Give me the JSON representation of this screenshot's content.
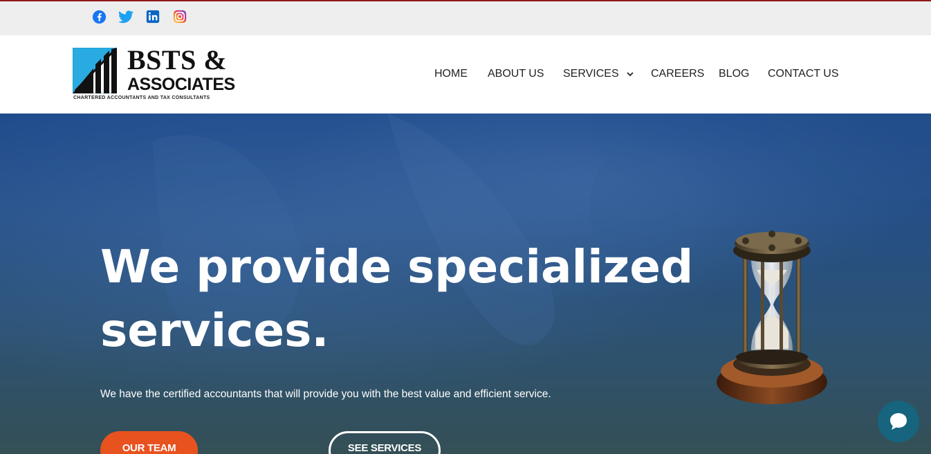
{
  "social": [
    {
      "name": "facebook-icon",
      "color": "#1877f2"
    },
    {
      "name": "twitter-icon",
      "color": "#1da1f2"
    },
    {
      "name": "linkedin-icon",
      "color": "#0a66c2"
    },
    {
      "name": "instagram-icon",
      "color": "#e1306c"
    }
  ],
  "logo": {
    "title": "BSTS &",
    "subtitle": "ASSOCIATES",
    "tagline": "CHARTERED ACCOUNTANTS AND TAX CONSULTANTS"
  },
  "nav": {
    "items": [
      {
        "label": "HOME"
      },
      {
        "label": "ABOUT US"
      },
      {
        "label": "SERVICES",
        "icon": "chevron-down-icon"
      },
      {
        "label": "CAREERS"
      },
      {
        "label": "BLOG"
      },
      {
        "label": "CONTACT US"
      }
    ]
  },
  "hero": {
    "heading": "We provide specialized services.",
    "subtext": "We have the certified accountants that will provide you with the best value and efficient service.",
    "primary_button": "OUR TEAM",
    "secondary_button": "SEE SERVICES"
  },
  "colors": {
    "accent_orange": "#e8521f",
    "top_border": "#8f1518",
    "chat_bubble": "#17647f"
  },
  "chat": {
    "icon": "chat-bubble-icon"
  }
}
